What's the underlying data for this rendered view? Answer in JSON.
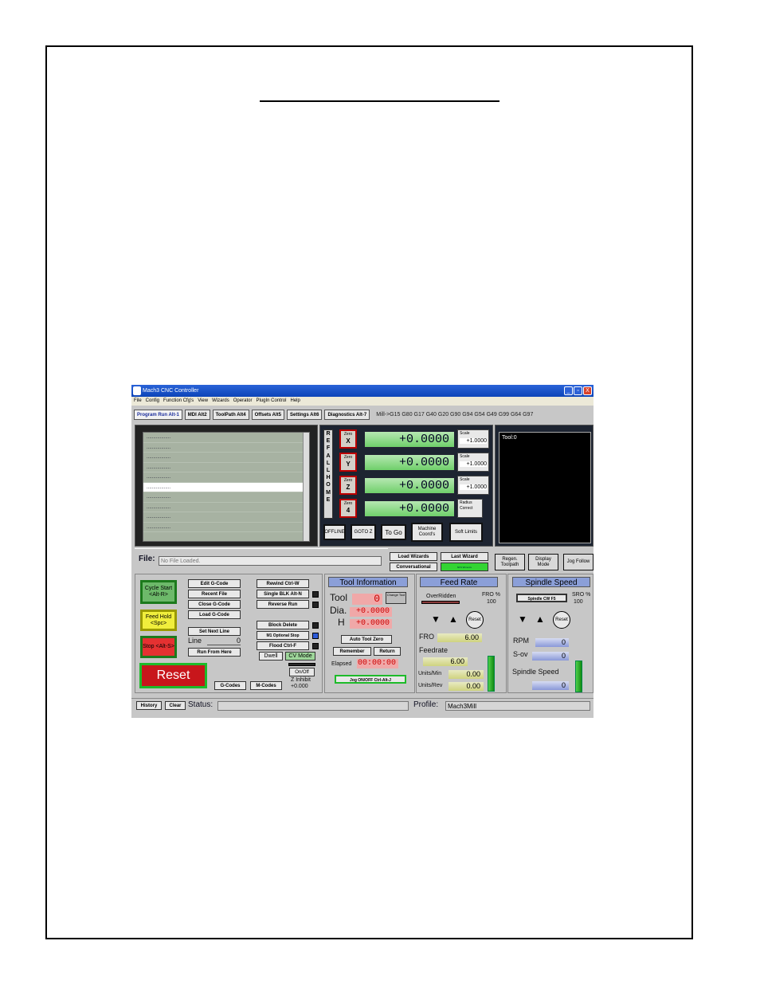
{
  "window": {
    "title": "Mach3 CNC Controller",
    "minimize": "_",
    "maximize": "▫",
    "close": "X"
  },
  "menu": [
    "File",
    "Config",
    "Function Cfg's",
    "View",
    "Wizards",
    "Operator",
    "PlugIn Control",
    "Help"
  ],
  "tabs": [
    "Program Run Alt-1",
    "MDI Alt2",
    "ToolPath Alt4",
    "Offsets Alt5",
    "Settings Alt6",
    "Diagnostics Alt-7"
  ],
  "modal_line": "Mill->G15  G80 G17 G40 G20 G90 G94 G54 G49 G99 G64 G97",
  "gcode_lines": [
    "..................",
    "..................",
    "..................",
    "..................",
    "..................",
    "..................",
    "..................",
    "..................",
    "..................",
    ".................."
  ],
  "refall": [
    "R",
    "E",
    "F",
    "A",
    "L",
    "L",
    "H",
    "O",
    "M",
    "E"
  ],
  "axes": [
    {
      "zero_label": "Zero",
      "axis": "X",
      "value": "+0.0000",
      "scale_label": "Scale",
      "scale": "+1.0000"
    },
    {
      "zero_label": "Zero",
      "axis": "Y",
      "value": "+0.0000",
      "scale_label": "Scale",
      "scale": "+1.0000"
    },
    {
      "zero_label": "Zero",
      "axis": "Z",
      "value": "+0.0000",
      "scale_label": "Scale",
      "scale": "+1.0000"
    },
    {
      "zero_label": "Zero",
      "axis": "4",
      "value": "+0.0000",
      "scale_label": "Radius Correct",
      "scale": ""
    }
  ],
  "dro_buttons": {
    "offline": "OFFLINE",
    "gotoz": "GOTO Z",
    "togo": "To Go",
    "machine": "Machine Coord's",
    "soft": "Soft Limits"
  },
  "toolview": {
    "label": "Tool:0"
  },
  "file": {
    "label": "File:",
    "value": "No File Loaded."
  },
  "wizards": {
    "load": "Load Wizards",
    "last": "Last Wizard",
    "conversational": "Conversational",
    "nfs": "NFS Wizards"
  },
  "view_buttons": {
    "regen": "Regen. Toolpath",
    "display": "Display Mode",
    "jog": "Jog Follow"
  },
  "run": {
    "cycle_start": "Cycle Start <Alt-R>",
    "feed_hold": "Feed Hold <Spc>",
    "stop": "Stop <Alt-S>",
    "edit": "Edit G-Code",
    "recent": "Recent File",
    "close": "Close G-Code",
    "load": "Load G-Code",
    "set_next": "Set Next Line",
    "line_label": "Line",
    "line_value": "0",
    "run_from": "Run From Here",
    "rewind": "Rewind Ctrl-W",
    "single": "Single BLK Alt-N",
    "reverse": "Reverse Run",
    "block_delete": "Block Delete",
    "m1": "M1 Optional Stop",
    "flood": "Flood Ctrl-F",
    "dwell": "Dwell",
    "cv": "CV Mode",
    "onoff": "On/Off",
    "zinhibit": "Z Inhibit",
    "zinhibit_value": "+0.000",
    "reset": "Reset",
    "gcodes": "G-Codes",
    "mcodes": "M-Codes"
  },
  "tool_info": {
    "title": "Tool Information",
    "tool_label": "Tool",
    "tool_value": "0",
    "change": "Change Tool",
    "dia_label": "Dia.",
    "dia_value": "+0.0000",
    "h_label": "H",
    "h_value": "+0.0000",
    "auto_zero": "Auto Tool Zero",
    "remember": "Remember",
    "return": "Return",
    "elapsed_label": "Elapsed",
    "elapsed_value": "00:00:00",
    "jog": "Jog ON/OFF Ctrl-Alt-J"
  },
  "feed_rate": {
    "title": "Feed Rate",
    "overridden": "OverRidden",
    "fro_pct": "FRO %",
    "fro_pct_value": "100",
    "reset": "Reset",
    "fro_label": "FRO",
    "fro_value": "6.00",
    "feedrate_label": "Feedrate",
    "feedrate_value": "6.00",
    "units_min_label": "Units/Min",
    "units_min_value": "0.00",
    "units_rev_label": "Units/Rev",
    "units_rev_value": "0.00"
  },
  "spindle": {
    "title": "Spindle Speed",
    "cw": "Spindle CW F5",
    "sro": "SRO %",
    "sro_value": "100",
    "reset": "Reset",
    "rpm_label": "RPM",
    "rpm_value": "0",
    "sov_label": "S-ov",
    "sov_value": "0",
    "speed_label": "Spindle Speed",
    "speed_value": "0"
  },
  "status": {
    "history": "History",
    "clear": "Clear",
    "status_label": "Status:",
    "profile_label": "Profile:",
    "profile_value": "Mach3Mill"
  },
  "colors": {
    "dro_green": "#6fcf6a",
    "title_blue": "#0c44b8",
    "section_blue": "#8b9fd8",
    "reset_red": "#c8161b"
  }
}
